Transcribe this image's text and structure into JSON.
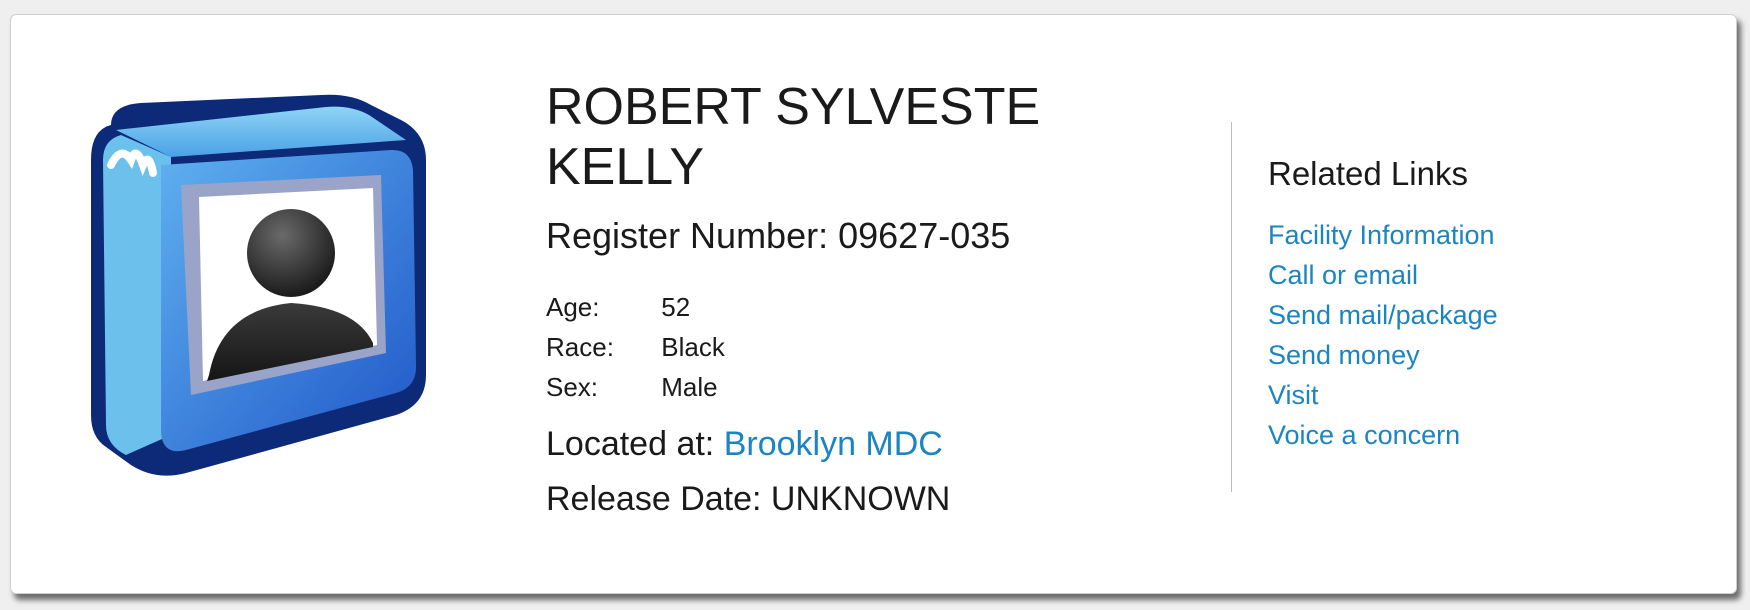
{
  "inmate": {
    "name_line1": "ROBERT SYLVESTE",
    "name_line2": "KELLY",
    "register_label": "Register Number:",
    "register_number": "09627-035",
    "details": [
      {
        "label": "Age:",
        "value": "52"
      },
      {
        "label": "Race:",
        "value": "Black"
      },
      {
        "label": "Sex:",
        "value": "Male"
      }
    ],
    "located_label": "Located at:",
    "location": "Brooklyn MDC",
    "release_label": "Release Date:",
    "release_date": "UNKNOWN",
    "photo_icon": "person-placeholder-icon"
  },
  "related": {
    "title": "Related Links",
    "links": [
      {
        "label": "Facility Information"
      },
      {
        "label": "Call or email"
      },
      {
        "label": "Send mail/package"
      },
      {
        "label": "Send money"
      },
      {
        "label": "Visit"
      },
      {
        "label": "Voice a concern"
      }
    ]
  },
  "colors": {
    "link": "#1a85c1",
    "text": "#1a1a1a",
    "divider": "#bdbdbd"
  }
}
